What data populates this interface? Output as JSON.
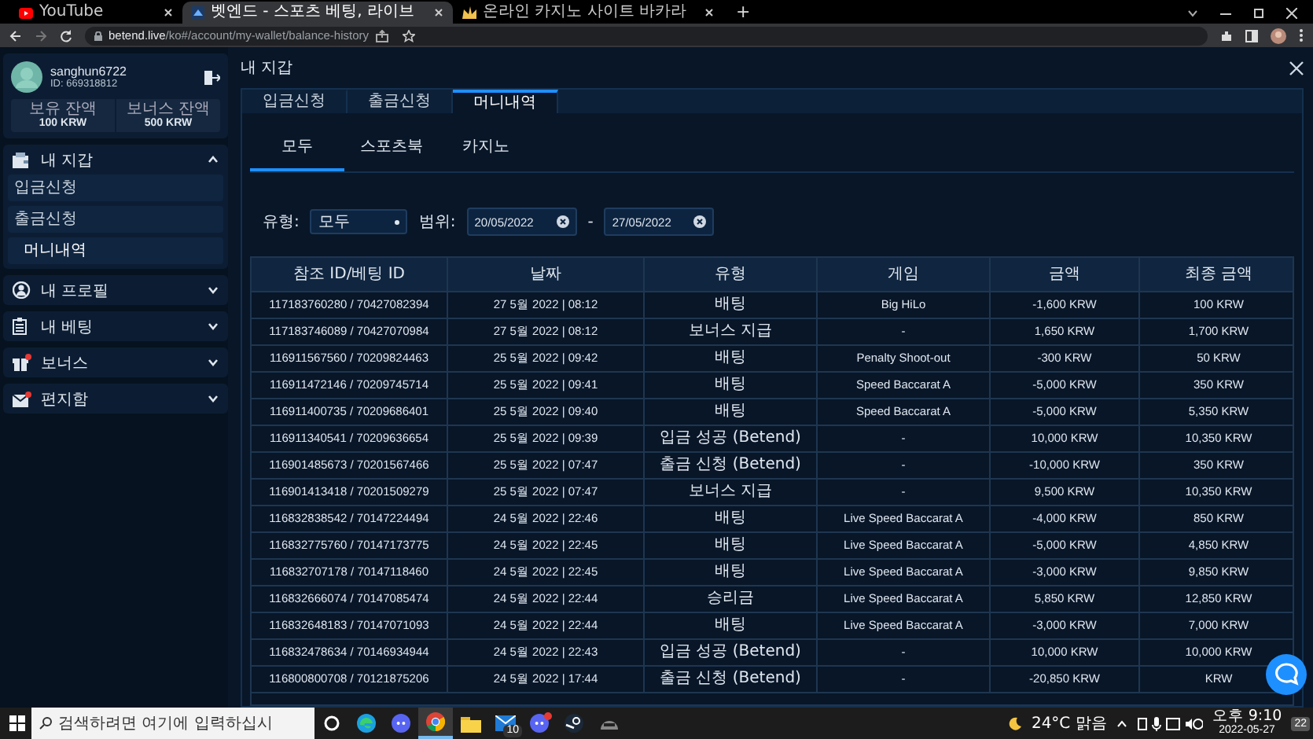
{
  "browser": {
    "tabs": [
      {
        "title": "YouTube",
        "kind": "youtube",
        "selected": false
      },
      {
        "title": "벳엔드 - 스포츠 베팅, 라이브",
        "kind": "site",
        "selected": true
      },
      {
        "title": "온라인 카지노 사이트 바카라",
        "kind": "casino",
        "selected": false
      }
    ],
    "new_tab": "+",
    "url_host": "betend.live",
    "url_path": "/ko#/account/my-wallet/balance-history"
  },
  "sidebar": {
    "user": {
      "name": "sanghun6722",
      "id": "ID: 669318812"
    },
    "balances": [
      {
        "label": "보유 잔액",
        "value": "100 KRW"
      },
      {
        "label": "보너스 잔액",
        "value": "500 KRW"
      }
    ],
    "menu": [
      {
        "label": "내 지갑",
        "kind": "wallet",
        "notification": false,
        "expanded": true,
        "children": [
          {
            "label": "입금신청",
            "selected": false
          },
          {
            "label": "출금신청",
            "selected": false
          },
          {
            "label": "머니내역",
            "selected": true
          }
        ]
      },
      {
        "label": "내 프로필",
        "kind": "profile",
        "notification": false,
        "expanded": false
      },
      {
        "label": "내 베팅",
        "kind": "bets",
        "notification": false,
        "expanded": false
      },
      {
        "label": "보너스",
        "kind": "bonus",
        "notification": true,
        "expanded": false
      },
      {
        "label": "편지함",
        "kind": "mail",
        "notification": true,
        "expanded": false
      }
    ]
  },
  "main": {
    "title": "내 지갑",
    "tabs": [
      {
        "label": "입금신청",
        "selected": false
      },
      {
        "label": "출금신청",
        "selected": false
      },
      {
        "label": "머니내역",
        "selected": true
      }
    ],
    "subtabs": [
      {
        "label": "모두",
        "selected": true
      },
      {
        "label": "스포츠북",
        "selected": false
      },
      {
        "label": "카지노",
        "selected": false
      }
    ],
    "filter": {
      "type_label": "유형:",
      "type_value": "모두",
      "range_label": "범위:",
      "from": "20/05/2022",
      "separator": "-",
      "to": "27/05/2022"
    },
    "table": {
      "columns": [
        "참조 ID/베팅 ID",
        "날짜",
        "유형",
        "게임",
        "금액",
        "최종 금액"
      ],
      "rows": [
        [
          "117183760280 / 70427082394",
          "27 5월 2022 | 08:12",
          "배팅",
          "Big HiLo",
          "-1,600 KRW",
          "100 KRW"
        ],
        [
          "117183746089 / 70427070984",
          "27 5월 2022 | 08:12",
          "보너스 지급",
          "-",
          "1,650 KRW",
          "1,700 KRW"
        ],
        [
          "116911567560 / 70209824463",
          "25 5월 2022 | 09:42",
          "배팅",
          "Penalty Shoot-out",
          "-300 KRW",
          "50 KRW"
        ],
        [
          "116911472146 / 70209745714",
          "25 5월 2022 | 09:41",
          "배팅",
          "Speed Baccarat A",
          "-5,000 KRW",
          "350 KRW"
        ],
        [
          "116911400735 / 70209686401",
          "25 5월 2022 | 09:40",
          "배팅",
          "Speed Baccarat A",
          "-5,000 KRW",
          "5,350 KRW"
        ],
        [
          "116911340541 / 70209636654",
          "25 5월 2022 | 09:39",
          "입금 성공 (Betend)",
          "-",
          "10,000 KRW",
          "10,350 KRW"
        ],
        [
          "116901485673 / 70201567466",
          "25 5월 2022 | 07:47",
          "출금 신청 (Betend)",
          "-",
          "-10,000 KRW",
          "350 KRW"
        ],
        [
          "116901413418 / 70201509279",
          "25 5월 2022 | 07:47",
          "보너스 지급",
          "-",
          "9,500 KRW",
          "10,350 KRW"
        ],
        [
          "116832838542 / 70147224494",
          "24 5월 2022 | 22:46",
          "배팅",
          "Live Speed Baccarat A",
          "-4,000 KRW",
          "850 KRW"
        ],
        [
          "116832775760 / 70147173775",
          "24 5월 2022 | 22:45",
          "배팅",
          "Live Speed Baccarat A",
          "-5,000 KRW",
          "4,850 KRW"
        ],
        [
          "116832707178 / 70147118460",
          "24 5월 2022 | 22:45",
          "배팅",
          "Live Speed Baccarat A",
          "-3,000 KRW",
          "9,850 KRW"
        ],
        [
          "116832666074 / 70147085474",
          "24 5월 2022 | 22:44",
          "승리금",
          "Live Speed Baccarat A",
          "5,850 KRW",
          "12,850 KRW"
        ],
        [
          "116832648183 / 70147071093",
          "24 5월 2022 | 22:44",
          "배팅",
          "Live Speed Baccarat A",
          "-3,000 KRW",
          "7,000 KRW"
        ],
        [
          "116832478634 / 70146934944",
          "24 5월 2022 | 22:43",
          "입금 성공 (Betend)",
          "-",
          "10,000 KRW",
          "10,000 KRW"
        ],
        [
          "116800800708 / 70121875206",
          "24 5월 2022 | 17:44",
          "출금 신청 (Betend)",
          "-",
          "-20,850 KRW",
          "KRW"
        ]
      ]
    }
  },
  "taskbar": {
    "search_placeholder": "검색하려면 여기에 입력하십시",
    "apps": [
      {
        "kind": "cortana",
        "active": false,
        "alert": false
      },
      {
        "kind": "edge",
        "active": false,
        "alert": false
      },
      {
        "kind": "discord",
        "active": false,
        "alert": false
      },
      {
        "kind": "chrome",
        "active": true,
        "alert": false
      },
      {
        "kind": "folder",
        "active": false,
        "alert": false
      },
      {
        "kind": "mail",
        "active": false,
        "alert": false,
        "badge": "10"
      },
      {
        "kind": "discord",
        "active": false,
        "alert": true
      },
      {
        "kind": "steam",
        "active": false,
        "alert": false
      },
      {
        "kind": "game",
        "active": false,
        "alert": false
      }
    ],
    "weather": "24°C 맑음",
    "time": "오후 9:10",
    "date": "2022-05-27",
    "notifications": "22"
  }
}
